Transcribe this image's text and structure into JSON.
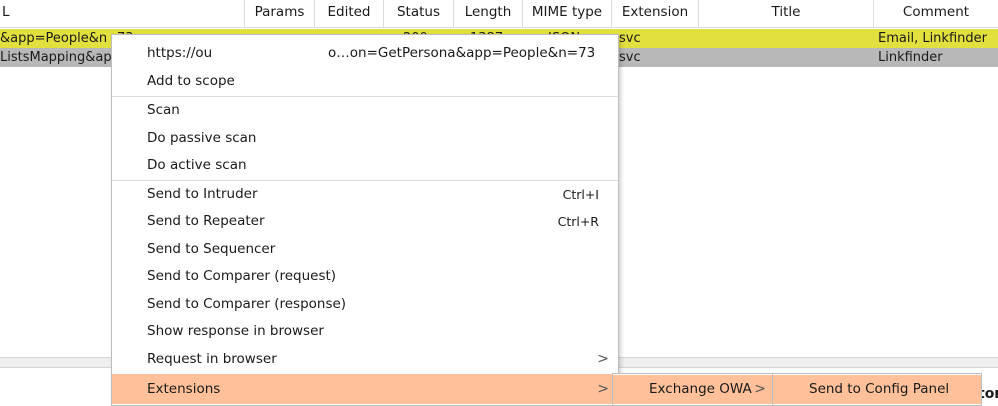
{
  "table": {
    "columns": [
      "L",
      "Params",
      "Edited",
      "Status",
      "Length",
      "MIME type",
      "Extension",
      "Title",
      "Comment"
    ],
    "rows": [
      {
        "url": "&app=People&n",
        "url_tail": "73",
        "status": "200",
        "length": "1387",
        "mime": "JSON",
        "extension": "svc",
        "comment": "Email, Linkfinder"
      },
      {
        "url": "ListsMapping&ap",
        "extension": "svc",
        "comment": "Linkfinder"
      }
    ]
  },
  "menu": {
    "url_item": {
      "start": "https://ou",
      "end": "o…on=GetPersona&app=People&n=73"
    },
    "items": {
      "add_to_scope": "Add to scope",
      "scan": "Scan",
      "passive_scan": "Do passive scan",
      "active_scan": "Do active scan",
      "send_intruder": "Send to Intruder",
      "send_intruder_shortcut": "Ctrl+I",
      "send_repeater": "Send to Repeater",
      "send_repeater_shortcut": "Ctrl+R",
      "send_sequencer": "Send to Sequencer",
      "send_comparer_request": "Send to Comparer (request)",
      "send_comparer_response": "Send to Comparer (response)",
      "show_response_browser": "Show response in browser",
      "request_in_browser": "Request in browser",
      "extensions": "Extensions"
    },
    "arrow_glyph": ">",
    "highlight_color": "#ffc09a"
  },
  "submenu_extensions": {
    "exchange_owa": "Exchange OWA"
  },
  "submenu_owa": {
    "send_config": "Send to Config Panel"
  },
  "bottom": {
    "partial_text": "tor"
  },
  "colors": {
    "row_selected": "#e2e03f",
    "row_gray": "#b8b8b8"
  }
}
